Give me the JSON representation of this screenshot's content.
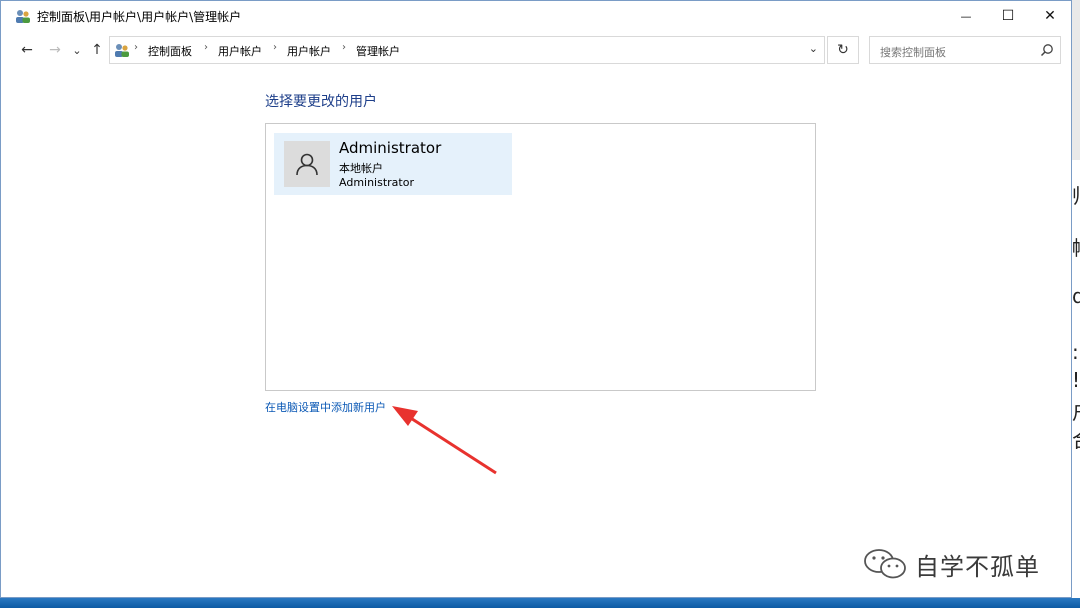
{
  "window": {
    "title": "控制面板\\用户帐户\\用户帐户\\管理帐户",
    "controls": {
      "minimize": "—",
      "maximize": "☐",
      "close": "✕"
    }
  },
  "nav": {
    "back": "←",
    "forward": "→",
    "recent": "⌄",
    "up": "↑"
  },
  "address": {
    "breadcrumbs": [
      "控制面板",
      "用户帐户",
      "用户帐户",
      "管理帐户"
    ],
    "separator": "›",
    "dropdown": "⌄",
    "refresh": "↻"
  },
  "search": {
    "placeholder": "搜索控制面板"
  },
  "main": {
    "heading": "选择要更改的用户",
    "users": [
      {
        "name": "Administrator",
        "type": "本地帐户",
        "sub": "Administrator"
      }
    ],
    "add_user_link": "在电脑设置中添加新用户"
  },
  "colors": {
    "heading": "#1e3f8a",
    "link": "#0a58b5",
    "selected_tile": "#e5f1fb",
    "annotation_arrow": "#e8322e"
  },
  "watermark": {
    "text": "自学不孤单"
  },
  "background_text": [
    "帅",
    "帐",
    "d",
    ":",
    "!.",
    "户",
    "合"
  ]
}
